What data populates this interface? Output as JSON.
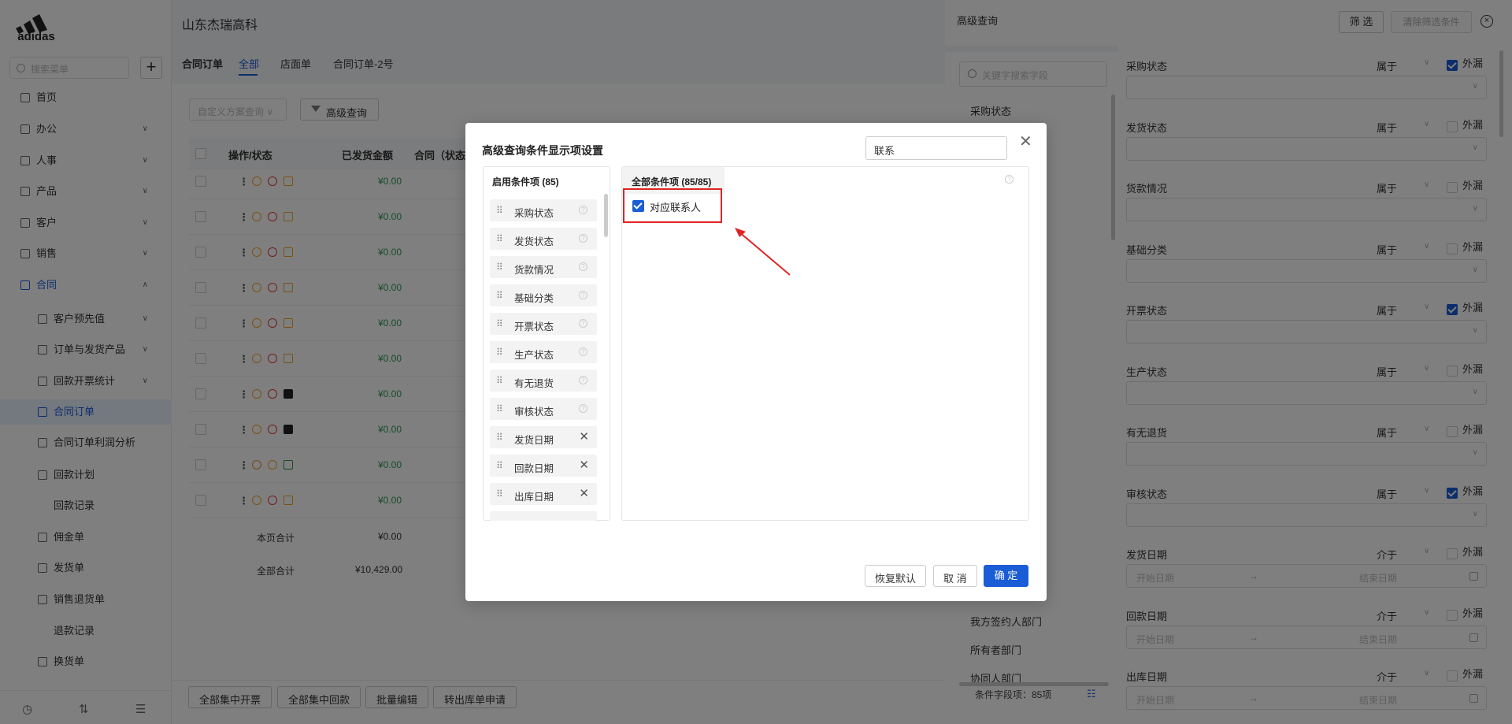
{
  "brand": {
    "logo_text": "adidas"
  },
  "sidebar": {
    "search_placeholder": "搜索菜单",
    "add_label": "+",
    "items": [
      {
        "label": "首页"
      },
      {
        "label": "办公"
      },
      {
        "label": "人事"
      },
      {
        "label": "产品"
      },
      {
        "label": "客户"
      },
      {
        "label": "销售"
      },
      {
        "label": "合同"
      },
      {
        "label": "客户预先值"
      },
      {
        "label": "订单与发货产品"
      },
      {
        "label": "回款开票统计"
      },
      {
        "label": "合同订单"
      },
      {
        "label": "合同订单利润分析"
      },
      {
        "label": "回款计划"
      },
      {
        "label": "回款记录"
      },
      {
        "label": "佣金单"
      },
      {
        "label": "发货单"
      },
      {
        "label": "销售退货单"
      },
      {
        "label": "退款记录"
      },
      {
        "label": "换货单"
      }
    ]
  },
  "header": {
    "company": "山东杰瑞高科"
  },
  "tabs": [
    {
      "label": "合同订单"
    },
    {
      "label": "全部"
    },
    {
      "label": "店面单"
    },
    {
      "label": "合同订单-2号"
    }
  ],
  "toolbar": {
    "scheme_placeholder": "自定义方案查询",
    "advanced_label": "高级查询"
  },
  "table": {
    "headers": {
      "op": "操作/状态",
      "shipped": "已发货金额",
      "contract": "合同（状态"
    },
    "amounts": [
      "¥0.00",
      "¥0.00",
      "¥0.00",
      "¥0.00",
      "¥0.00",
      "¥0.00",
      "¥0.00",
      "¥0.00",
      "¥0.00",
      "¥0.00"
    ],
    "page_total_label": "本页合计",
    "page_total_value": "¥0.00",
    "all_total_label": "全部合计",
    "all_total_value": "¥10,429.00"
  },
  "bottom_buttons": [
    "全部集中开票",
    "全部集中回款",
    "批量编辑",
    "转出库单申请"
  ],
  "drawer": {
    "title": "高级查询",
    "filter_button": "筛 选",
    "clear_button": "清除筛选条件",
    "search_placeholder": "关键字搜索字段",
    "left_fields": [
      "采购状态",
      "我方签约人部门",
      "所有者部门",
      "协同人部门"
    ],
    "field_count": "条件字段项：85项",
    "fields": [
      {
        "label": "采购状态",
        "op": "属于",
        "exclude": "外漏",
        "checked": true,
        "kind": "select"
      },
      {
        "label": "发货状态",
        "op": "属于",
        "exclude": "外漏",
        "checked": false,
        "kind": "select"
      },
      {
        "label": "货款情况",
        "op": "属于",
        "exclude": "外漏",
        "checked": false,
        "kind": "select"
      },
      {
        "label": "基础分类",
        "op": "属于",
        "exclude": "外漏",
        "checked": false,
        "kind": "select"
      },
      {
        "label": "开票状态",
        "op": "属于",
        "exclude": "外漏",
        "checked": true,
        "kind": "select"
      },
      {
        "label": "生产状态",
        "op": "属于",
        "exclude": "外漏",
        "checked": false,
        "kind": "select"
      },
      {
        "label": "有无退货",
        "op": "属于",
        "exclude": "外漏",
        "checked": false,
        "kind": "select"
      },
      {
        "label": "审核状态",
        "op": "属于",
        "exclude": "外漏",
        "checked": true,
        "kind": "select"
      },
      {
        "label": "发货日期",
        "op": "介于",
        "exclude": "外漏",
        "checked": false,
        "kind": "date"
      },
      {
        "label": "回款日期",
        "op": "介于",
        "exclude": "外漏",
        "checked": false,
        "kind": "date"
      },
      {
        "label": "出库日期",
        "op": "介于",
        "exclude": "外漏",
        "checked": false,
        "kind": "date"
      }
    ],
    "date_start": "开始日期",
    "date_end": "结束日期"
  },
  "modal": {
    "title": "高级查询条件显示项设置",
    "search_value": "联系",
    "enabled_header": "启用条件项 (85)",
    "all_header": "全部条件项 (85/85)",
    "enabled_items": [
      {
        "label": "采购状态",
        "removable": false
      },
      {
        "label": "发货状态",
        "removable": false
      },
      {
        "label": "货款情况",
        "removable": false
      },
      {
        "label": "基础分类",
        "removable": false
      },
      {
        "label": "开票状态",
        "removable": false
      },
      {
        "label": "生产状态",
        "removable": false
      },
      {
        "label": "有无退货",
        "removable": false
      },
      {
        "label": "审核状态",
        "removable": false
      },
      {
        "label": "发货日期",
        "removable": true
      },
      {
        "label": "回款日期",
        "removable": true
      },
      {
        "label": "出库日期",
        "removable": true
      }
    ],
    "matched_item": "对应联系人",
    "restore_button": "恢复默认",
    "cancel_button": "取 消",
    "ok_button": "确 定"
  },
  "colors": {
    "accent": "#1a5dd6",
    "highlight": "#e02424"
  }
}
